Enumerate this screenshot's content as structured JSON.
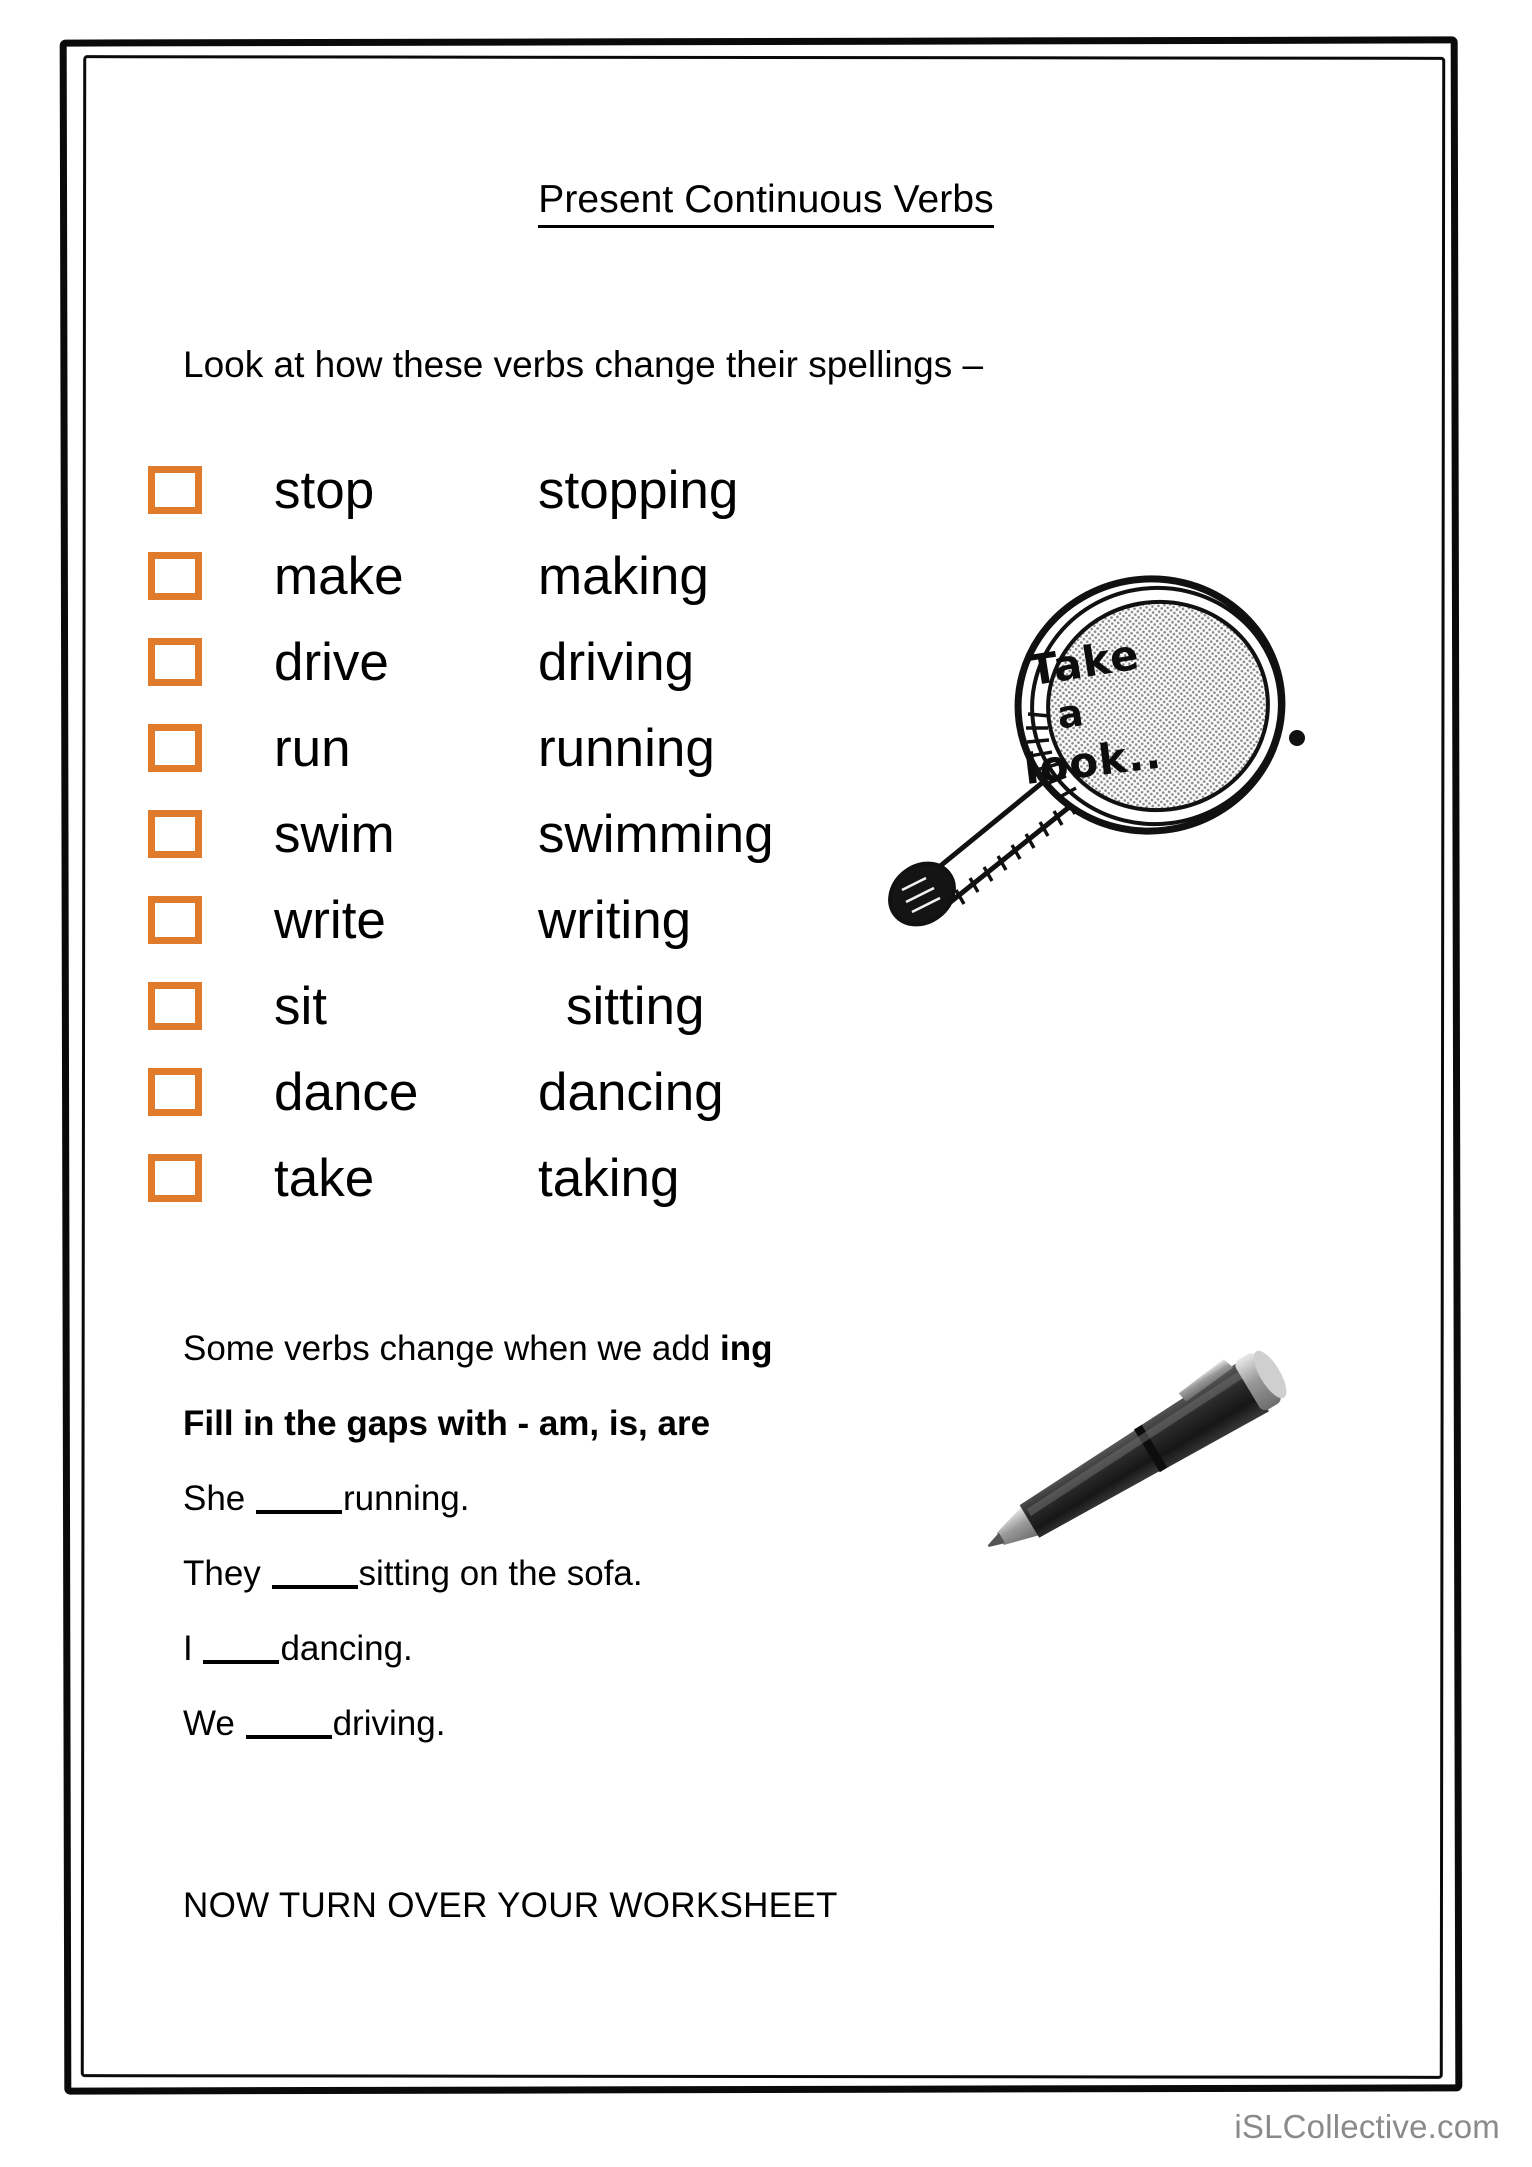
{
  "page": {
    "title": "Present Continuous Verbs",
    "intro": "Look at how these verbs change their spellings –"
  },
  "verbs": [
    {
      "base": "stop",
      "ing": "stopping",
      "indent": false
    },
    {
      "base": "make",
      "ing": "making",
      "indent": false
    },
    {
      "base": "drive",
      "ing": "driving",
      "indent": false
    },
    {
      "base": "run",
      "ing": "running",
      "indent": false
    },
    {
      "base": "swim",
      "ing": "swimming",
      "indent": false
    },
    {
      "base": "write",
      "ing": "writing",
      "indent": false
    },
    {
      "base": "sit",
      "ing": "sitting",
      "indent": true
    },
    {
      "base": "dance",
      "ing": "dancing",
      "indent": false
    },
    {
      "base": "take",
      "ing": "taking",
      "indent": false
    }
  ],
  "illustrations": {
    "magnifier_caption_line1": "Take",
    "magnifier_caption_line2": "a",
    "magnifier_caption_line3": "look..",
    "magnifier_name": "magnifying-glass",
    "pen_name": "ballpoint-pen"
  },
  "exercise": {
    "note_prefix": "Some verbs change when we add ",
    "note_bold": "ing",
    "instruction": "Fill in the gaps with -  am, is, are",
    "sentences": [
      {
        "before": "She ",
        "after": "running."
      },
      {
        "before": "They ",
        "after": "sitting on the sofa."
      },
      {
        "before": "I ",
        "after": "dancing."
      },
      {
        "before": "We ",
        "after": "driving."
      }
    ],
    "turnover": "NOW TURN OVER YOUR WORKSHEET"
  },
  "footer": {
    "watermark": "iSLCollective.com"
  },
  "colors": {
    "checkbox_orange": "#e07b2c",
    "text_black": "#000000",
    "watermark_gray": "#8a8a8a"
  }
}
